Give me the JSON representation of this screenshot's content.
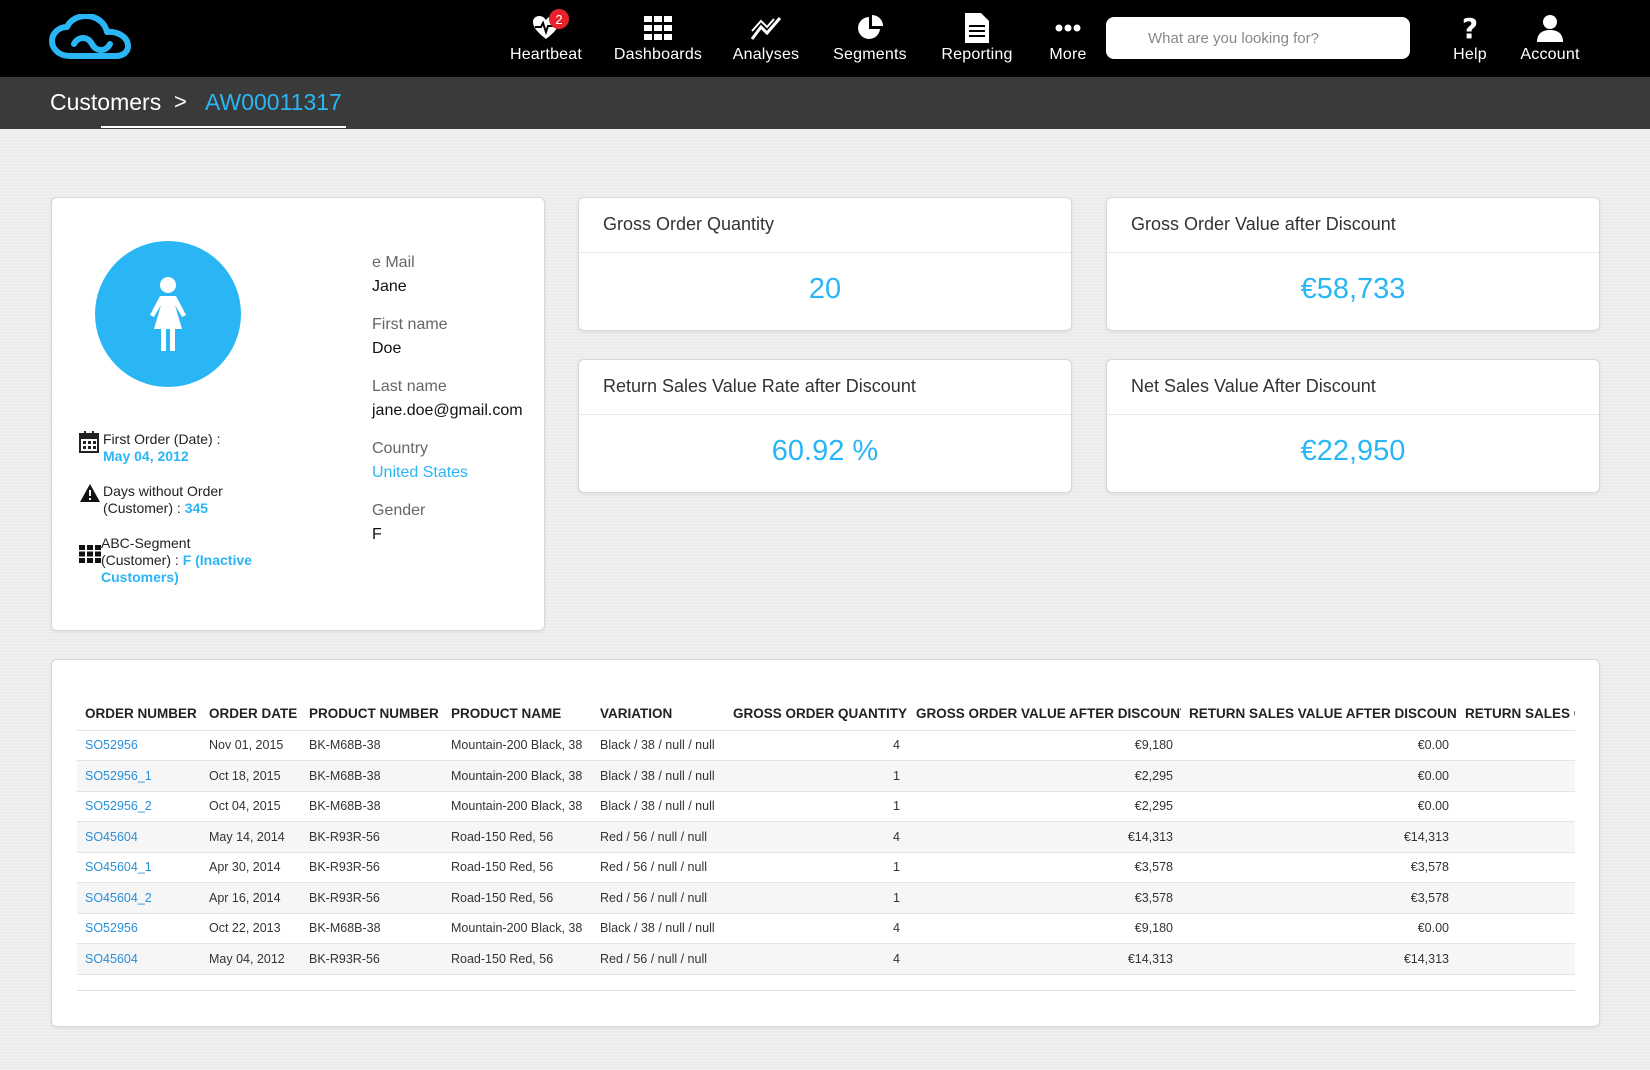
{
  "nav": {
    "items": [
      {
        "label": "Heartbeat",
        "badge": "2"
      },
      {
        "label": "Dashboards"
      },
      {
        "label": "Analyses"
      },
      {
        "label": "Segments"
      },
      {
        "label": "Reporting"
      },
      {
        "label": "More"
      }
    ],
    "search_placeholder": "What are you looking for?",
    "help_label": "Help",
    "account_label": "Account"
  },
  "breadcrumb": {
    "root": "Customers",
    "separator": ">",
    "current": "AW00011317"
  },
  "profile": {
    "first_order_label": "First Order (Date) :",
    "first_order_value": "May 04, 2012",
    "days_label_1": "Days without Order",
    "days_label_2": "(Customer) :",
    "days_value": "345",
    "segment_label_1": "ABC-Segment",
    "segment_label_2": "(Customer) :",
    "segment_value_1": "F (Inactive",
    "segment_value_2": "Customers)",
    "fields": [
      {
        "label": "e Mail",
        "value": "Jane"
      },
      {
        "label": "First name",
        "value": "Doe"
      },
      {
        "label": "Last name",
        "value": "jane.doe@gmail.com"
      },
      {
        "label": "Country",
        "value": "United States"
      },
      {
        "label": "Gender",
        "value": "F"
      }
    ]
  },
  "kpis": [
    {
      "title": "Gross Order Quantity",
      "value": "20"
    },
    {
      "title": "Gross Order Value after Discount",
      "value": "€58,733"
    },
    {
      "title": "Return Sales Value Rate after Discount",
      "value": "60.92 %"
    },
    {
      "title": "Net Sales Value After Discount",
      "value": "€22,950"
    }
  ],
  "orders": {
    "headers": [
      "ORDER NUMBER",
      "ORDER DATE",
      "PRODUCT NUMBER",
      "PRODUCT NAME",
      "VARIATION",
      "GROSS ORDER QUANTITY",
      "GROSS ORDER VALUE AFTER DISCOUNT",
      "RETURN SALES VALUE AFTER DISCOUNT",
      "RETURN SALES C"
    ],
    "rows": [
      [
        "SO52956",
        "Nov 01, 2015",
        "BK-M68B-38",
        "Mountain-200 Black, 38",
        "Black / 38 / null / null",
        "4",
        "€9,180",
        "€0.00",
        ""
      ],
      [
        "SO52956_1",
        "Oct 18, 2015",
        "BK-M68B-38",
        "Mountain-200 Black, 38",
        "Black / 38 / null / null",
        "1",
        "€2,295",
        "€0.00",
        ""
      ],
      [
        "SO52956_2",
        "Oct 04, 2015",
        "BK-M68B-38",
        "Mountain-200 Black, 38",
        "Black / 38 / null / null",
        "1",
        "€2,295",
        "€0.00",
        ""
      ],
      [
        "SO45604",
        "May 14, 2014",
        "BK-R93R-56",
        "Road-150 Red, 56",
        "Red / 56 / null / null",
        "4",
        "€14,313",
        "€14,313",
        ""
      ],
      [
        "SO45604_1",
        "Apr 30, 2014",
        "BK-R93R-56",
        "Road-150 Red, 56",
        "Red / 56 / null / null",
        "1",
        "€3,578",
        "€3,578",
        ""
      ],
      [
        "SO45604_2",
        "Apr 16, 2014",
        "BK-R93R-56",
        "Road-150 Red, 56",
        "Red / 56 / null / null",
        "1",
        "€3,578",
        "€3,578",
        ""
      ],
      [
        "SO52956",
        "Oct 22, 2013",
        "BK-M68B-38",
        "Mountain-200 Black, 38",
        "Black / 38 / null / null",
        "4",
        "€9,180",
        "€0.00",
        ""
      ],
      [
        "SO45604",
        "May 04, 2012",
        "BK-R93R-56",
        "Road-150 Red, 56",
        "Red / 56 / null / null",
        "4",
        "€14,313",
        "€14,313",
        ""
      ]
    ]
  },
  "colors": {
    "accent": "#2ab6f5",
    "topbar": "#000000",
    "crumbbar": "#3a3a3a",
    "badge": "#e8222b"
  }
}
